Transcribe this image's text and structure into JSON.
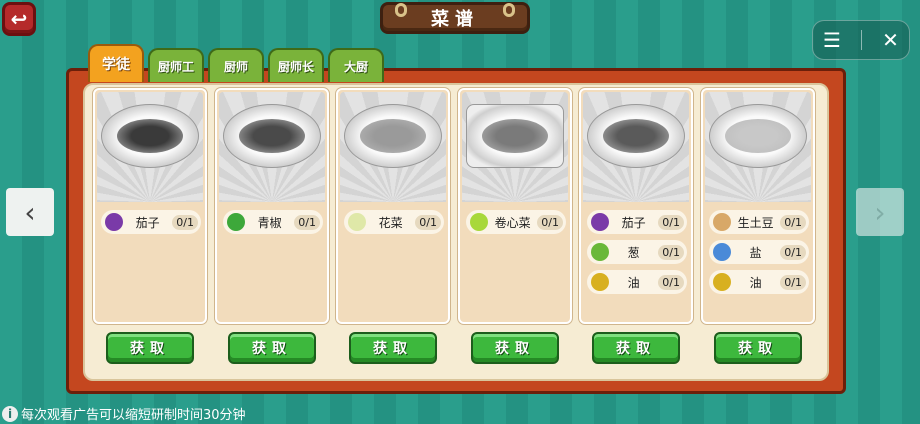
{
  "header": {
    "title": "菜谱"
  },
  "tabs": [
    {
      "label": "学徒",
      "active": true
    },
    {
      "label": "厨师工",
      "active": false
    },
    {
      "label": "厨师",
      "active": false
    },
    {
      "label": "厨师长",
      "active": false
    },
    {
      "label": "大厨",
      "active": false
    }
  ],
  "icons": {
    "back": "back-arrow-icon",
    "menu": "menu-icon",
    "close": "close-icon",
    "prev": "chevron-left-icon",
    "next": "chevron-right-icon",
    "info": "info-icon"
  },
  "recipes": [
    {
      "food_color": "#3a3a3a",
      "plate": "round",
      "get_label": "获取",
      "ingredients": [
        {
          "name": "茄子",
          "count": "0/1",
          "icon": "eggplant-icon",
          "color": "#7a3aa8"
        }
      ]
    },
    {
      "food_color": "#4a4a4a",
      "plate": "round",
      "get_label": "获取",
      "ingredients": [
        {
          "name": "青椒",
          "count": "0/1",
          "icon": "green-pepper-icon",
          "color": "#3da83a"
        }
      ]
    },
    {
      "food_color": "#9a9a9a",
      "plate": "round",
      "get_label": "获取",
      "ingredients": [
        {
          "name": "花菜",
          "count": "0/1",
          "icon": "cauliflower-icon",
          "color": "#dfe8a8"
        }
      ]
    },
    {
      "food_color": "#7a7a7a",
      "plate": "square",
      "get_label": "获取",
      "ingredients": [
        {
          "name": "卷心菜",
          "count": "0/1",
          "icon": "cabbage-icon",
          "color": "#a8d83a"
        }
      ]
    },
    {
      "food_color": "#5a5a5a",
      "plate": "round",
      "get_label": "获取",
      "ingredients": [
        {
          "name": "茄子",
          "count": "0/1",
          "icon": "eggplant-icon",
          "color": "#7a3aa8"
        },
        {
          "name": "葱",
          "count": "0/1",
          "icon": "scallion-icon",
          "color": "#6ab83a"
        },
        {
          "name": "油",
          "count": "0/1",
          "icon": "oil-bottle-icon",
          "color": "#d8b020"
        }
      ]
    },
    {
      "food_color": "#c8c8c8",
      "plate": "round",
      "get_label": "获取",
      "ingredients": [
        {
          "name": "生土豆",
          "count": "0/1",
          "icon": "potato-icon",
          "color": "#d8a868"
        },
        {
          "name": "盐",
          "count": "0/1",
          "icon": "salt-icon",
          "color": "#4a8ad8"
        },
        {
          "name": "油",
          "count": "0/1",
          "icon": "oil-bottle-icon",
          "color": "#d8b020"
        }
      ]
    }
  ],
  "footer": {
    "tip": "每次观看广告可以缩短研制时间30分钟"
  }
}
